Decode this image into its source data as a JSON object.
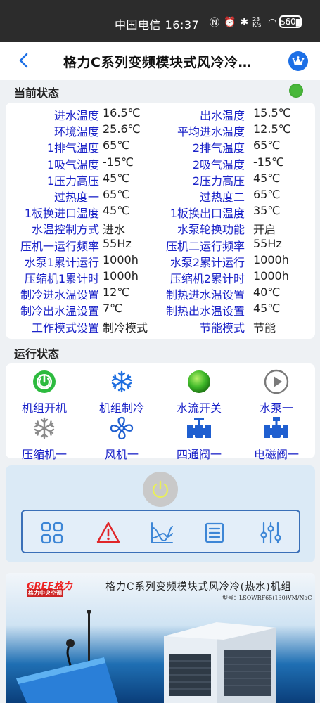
{
  "status_bar": {
    "carrier_time": "中国电信 16:37",
    "network_speed": "23 K/s",
    "signal": "5G",
    "battery": "60"
  },
  "header": {
    "title": "格力C系列变频模块式风冷冷…",
    "back_icon": "chevron-left-icon",
    "crown_icon": "crown-icon"
  },
  "current_status": {
    "title": "当前状态",
    "indicator_color": "#49b83a",
    "rows": [
      {
        "k1": "进水温度",
        "v1": "16.5℃",
        "k2": "出水温度",
        "v2": "15.5℃"
      },
      {
        "k1": "环境温度",
        "v1": "25.6℃",
        "k2": "平均进水温度",
        "v2": "12.5℃"
      },
      {
        "k1": "1排气温度",
        "v1": "65℃",
        "k2": "2排气温度",
        "v2": "65℃"
      },
      {
        "k1": "1吸气温度",
        "v1": "-15℃",
        "k2": "2吸气温度",
        "v2": "-15℃"
      },
      {
        "k1": "1压力高压",
        "v1": "45℃",
        "k2": "2压力高压",
        "v2": "45℃"
      },
      {
        "k1": "过热度一",
        "v1": "65℃",
        "k2": "过热度二",
        "v2": "65℃"
      },
      {
        "k1": "1板换进口温度",
        "v1": "45℃",
        "k2": "1板换出口温度",
        "v2": "35℃"
      },
      {
        "k1": "水温控制方式",
        "v1": "进水",
        "k2": "水泵轮换功能",
        "v2": "开启"
      },
      {
        "k1": "压机一运行频率",
        "v1": "55Hz",
        "k2": "压机二运行频率",
        "v2": "55Hz"
      },
      {
        "k1": "水泵1累计运行",
        "v1": "1000h",
        "k2": "水泵2累计运行",
        "v2": "1000h"
      },
      {
        "k1": "压缩机1累计时",
        "v1": "1000h",
        "k2": "压缩机2累计时",
        "v2": "1000h"
      },
      {
        "k1": "制冷进水温设置",
        "v1": "12℃",
        "k2": "制热进水温设置",
        "v2": "40℃"
      },
      {
        "k1": "制冷出水温设置",
        "v1": "7℃",
        "k2": "制热出水温设置",
        "v2": "45℃"
      },
      {
        "k1": "工作模式设置",
        "v1": "制冷模式",
        "k2": "节能模式",
        "v2": "节能"
      }
    ]
  },
  "run_status": {
    "title": "运行状态",
    "items": [
      {
        "label": "机组开机",
        "icon": "power-on-icon"
      },
      {
        "label": "机组制冷",
        "icon": "snowflake-icon"
      },
      {
        "label": "水流开关",
        "icon": "flow-switch-icon"
      },
      {
        "label": "水泵一",
        "icon": "pump-play-icon"
      },
      {
        "label": "压缩机一",
        "icon": "compressor-snowflake-icon"
      },
      {
        "label": "风机一",
        "icon": "fan-icon"
      },
      {
        "label": "四通阀一",
        "icon": "valve-icon"
      },
      {
        "label": "电磁阀一",
        "icon": "valve-icon"
      }
    ]
  },
  "controls": {
    "power_icon": "power-button-icon",
    "tools": [
      "grid-icon",
      "warning-icon",
      "chart-icon",
      "list-icon",
      "sliders-icon"
    ]
  },
  "banner": {
    "brand": "GREE格力",
    "brand_sub": "格力中央空调",
    "title": "格力C系列变频模块式风冷冷(热水)机组",
    "model": "型号：LSQWRF65(130)VM/NaC"
  }
}
